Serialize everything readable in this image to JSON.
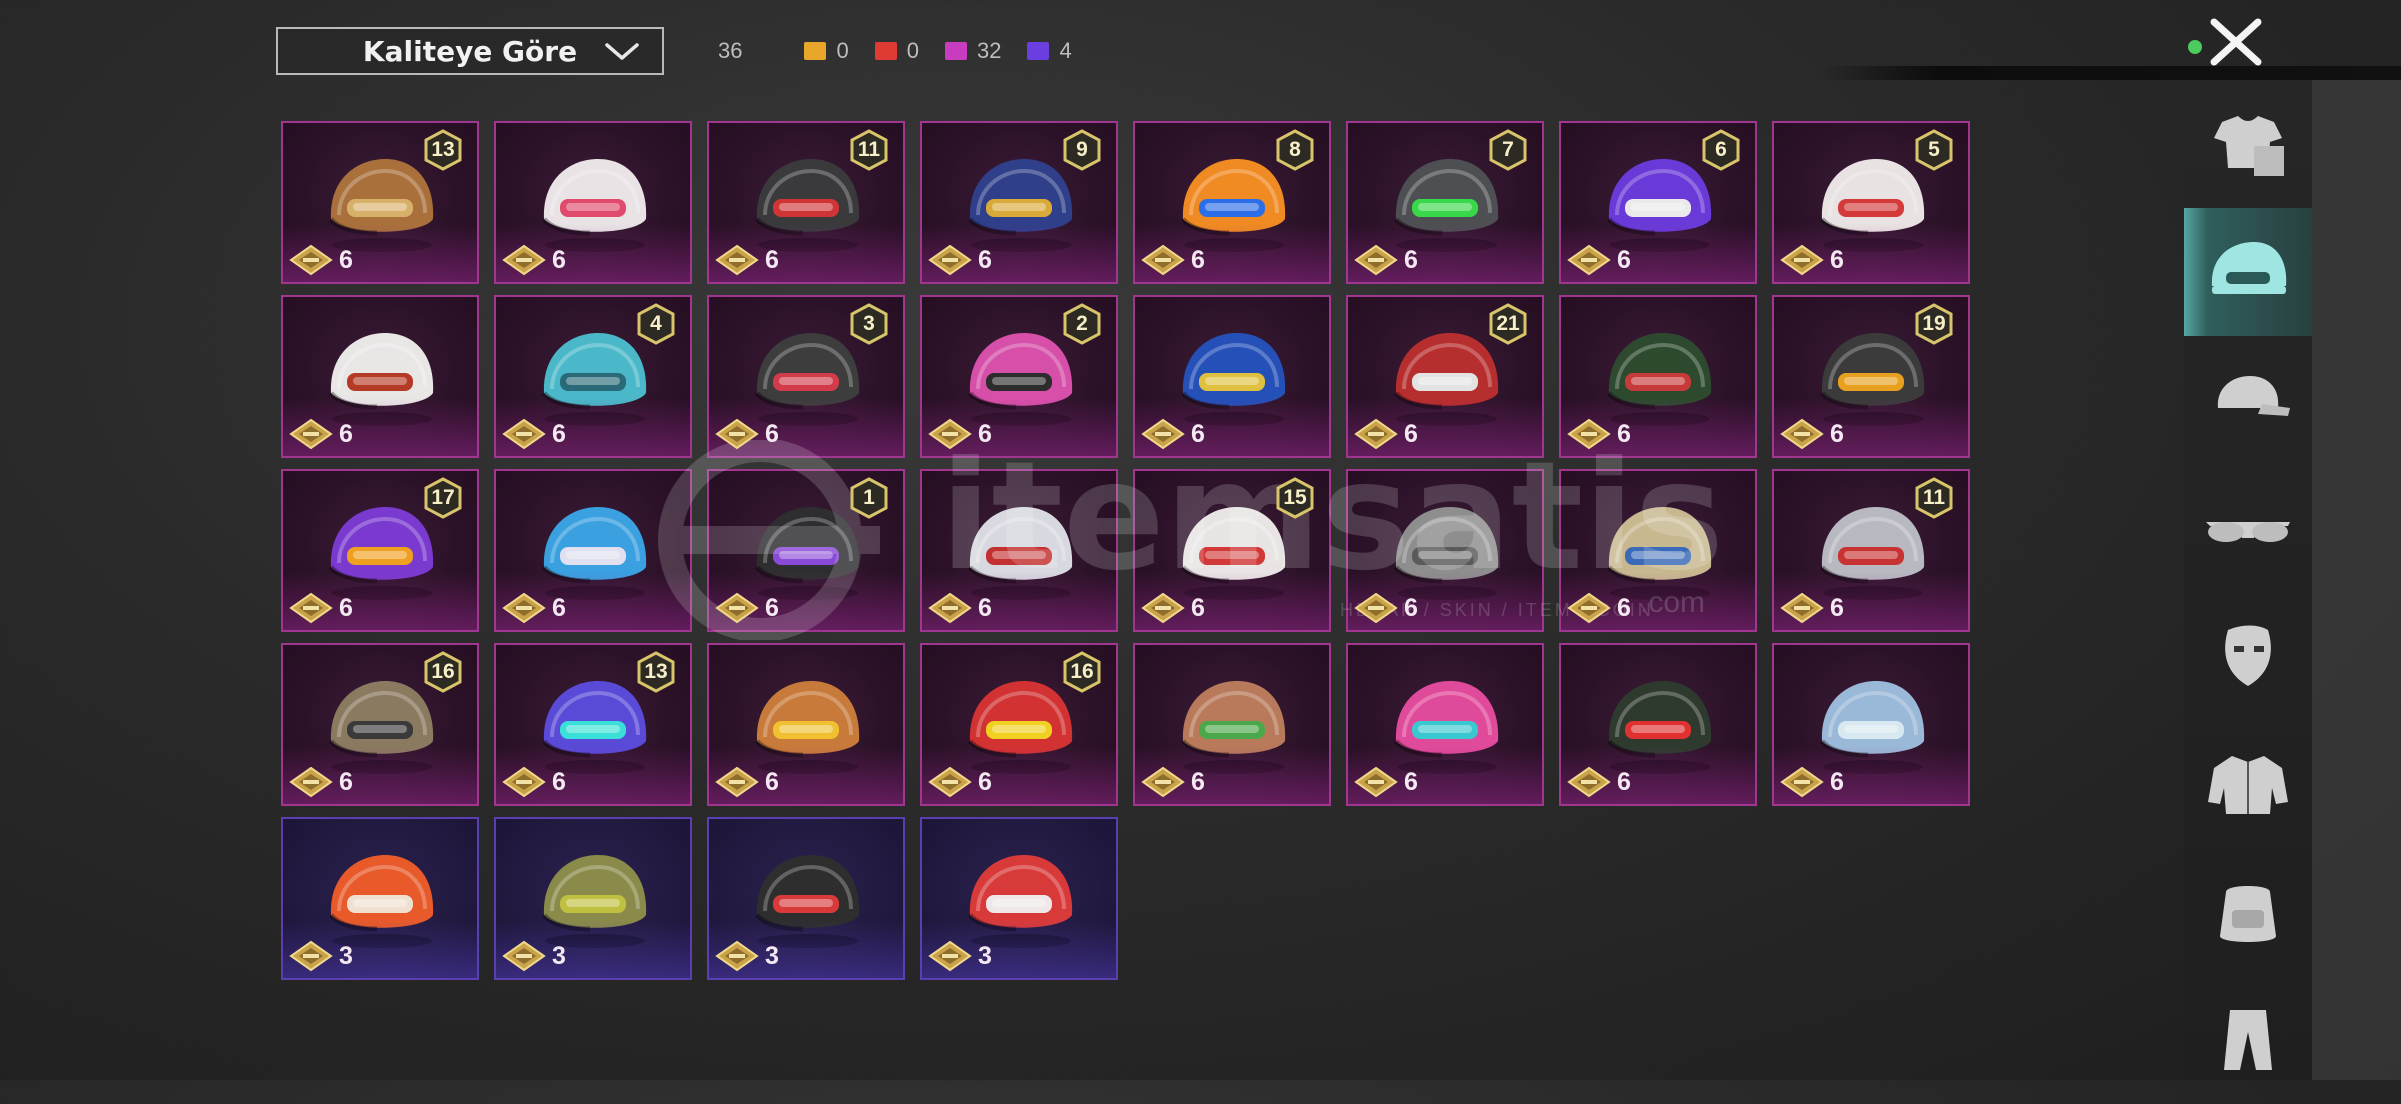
{
  "sort": {
    "label": "Kaliteye Göre"
  },
  "counts": {
    "total": "36",
    "tiers": [
      {
        "color": "#e8a72b",
        "value": "0"
      },
      {
        "color": "#e03a34",
        "value": "0"
      },
      {
        "color": "#c83cc0",
        "value": "32"
      },
      {
        "color": "#6b3ee0",
        "value": "4"
      }
    ]
  },
  "sidebar": {
    "items": [
      {
        "icon": "outfit-icon",
        "active": false
      },
      {
        "icon": "helmet-icon",
        "active": true
      },
      {
        "icon": "cap-icon",
        "active": false
      },
      {
        "icon": "sunglasses-icon",
        "active": false
      },
      {
        "icon": "mask-icon",
        "active": false
      },
      {
        "icon": "jacket-icon",
        "active": false
      },
      {
        "icon": "backpack-icon",
        "active": false
      },
      {
        "icon": "pants-icon",
        "active": false
      }
    ]
  },
  "items": [
    {
      "badge": "13",
      "cost": "6",
      "rarity": "mythic",
      "colors": [
        "#a9703c",
        "#d7b06a"
      ]
    },
    {
      "badge": "",
      "cost": "6",
      "rarity": "mythic",
      "colors": [
        "#e9e3e6",
        "#e04a6c"
      ]
    },
    {
      "badge": "11",
      "cost": "6",
      "rarity": "mythic",
      "colors": [
        "#3a3a3d",
        "#d13434"
      ]
    },
    {
      "badge": "9",
      "cost": "6",
      "rarity": "mythic",
      "colors": [
        "#2f3f8a",
        "#d9a93a"
      ]
    },
    {
      "badge": "8",
      "cost": "6",
      "rarity": "mythic",
      "colors": [
        "#f08a22",
        "#2b6ee8"
      ]
    },
    {
      "badge": "7",
      "cost": "6",
      "rarity": "mythic",
      "colors": [
        "#4d4f52",
        "#39d84a"
      ]
    },
    {
      "badge": "6",
      "cost": "6",
      "rarity": "mythic",
      "colors": [
        "#6a3ad8",
        "#eaeaea"
      ]
    },
    {
      "badge": "5",
      "cost": "6",
      "rarity": "mythic",
      "colors": [
        "#e8e2e2",
        "#d43a3a"
      ]
    },
    {
      "badge": "",
      "cost": "6",
      "rarity": "mythic",
      "colors": [
        "#e9e6e6",
        "#b53a26"
      ]
    },
    {
      "badge": "4",
      "cost": "6",
      "rarity": "mythic",
      "colors": [
        "#4ab8c8",
        "#2a6a78"
      ]
    },
    {
      "badge": "3",
      "cost": "6",
      "rarity": "mythic",
      "colors": [
        "#3d3d3d",
        "#d23c4a"
      ]
    },
    {
      "badge": "2",
      "cost": "6",
      "rarity": "mythic",
      "colors": [
        "#d64fa8",
        "#2c2c2c"
      ]
    },
    {
      "badge": "",
      "cost": "6",
      "rarity": "mythic",
      "colors": [
        "#2450b8",
        "#e0c040"
      ]
    },
    {
      "badge": "21",
      "cost": "6",
      "rarity": "mythic",
      "colors": [
        "#b72e2e",
        "#e3e3e3"
      ]
    },
    {
      "badge": "",
      "cost": "6",
      "rarity": "mythic",
      "colors": [
        "#2e4a2e",
        "#c63a3a"
      ]
    },
    {
      "badge": "19",
      "cost": "6",
      "rarity": "mythic",
      "colors": [
        "#3b3b3b",
        "#e8a020"
      ]
    },
    {
      "badge": "17",
      "cost": "6",
      "rarity": "mythic",
      "colors": [
        "#7a3ad0",
        "#f0a020"
      ]
    },
    {
      "badge": "",
      "cost": "6",
      "rarity": "mythic",
      "colors": [
        "#3aa0e0",
        "#e0e0f0"
      ]
    },
    {
      "badge": "1",
      "cost": "6",
      "rarity": "mythic",
      "colors": [
        "#2e2e30",
        "#8a4ad8"
      ]
    },
    {
      "badge": "",
      "cost": "6",
      "rarity": "mythic",
      "colors": [
        "#d8d8e0",
        "#c43030"
      ]
    },
    {
      "badge": "15",
      "cost": "6",
      "rarity": "mythic",
      "colors": [
        "#e8e4e4",
        "#d23838"
      ]
    },
    {
      "badge": "",
      "cost": "6",
      "rarity": "mythic",
      "colors": [
        "#8e8e8e",
        "#5a5a5a"
      ]
    },
    {
      "badge": "",
      "cost": "6",
      "rarity": "mythic",
      "colors": [
        "#c8b890",
        "#3a6ab8"
      ]
    },
    {
      "badge": "11",
      "cost": "6",
      "rarity": "mythic",
      "colors": [
        "#b8b8c0",
        "#c83232"
      ]
    },
    {
      "badge": "16",
      "cost": "6",
      "rarity": "mythic",
      "colors": [
        "#8a7a60",
        "#3a3a3a"
      ]
    },
    {
      "badge": "13",
      "cost": "6",
      "rarity": "mythic",
      "colors": [
        "#5a4ad8",
        "#3ae0d8"
      ]
    },
    {
      "badge": "",
      "cost": "6",
      "rarity": "mythic",
      "colors": [
        "#c87a3a",
        "#f0c030"
      ]
    },
    {
      "badge": "16",
      "cost": "6",
      "rarity": "mythic",
      "colors": [
        "#d23232",
        "#f0d020"
      ]
    },
    {
      "badge": "",
      "cost": "6",
      "rarity": "mythic",
      "colors": [
        "#b87a5a",
        "#4aa84a"
      ]
    },
    {
      "badge": "",
      "cost": "6",
      "rarity": "mythic",
      "colors": [
        "#e04a9a",
        "#3ac8d0"
      ]
    },
    {
      "badge": "",
      "cost": "6",
      "rarity": "mythic",
      "colors": [
        "#2e3a2e",
        "#e03030"
      ]
    },
    {
      "badge": "",
      "cost": "6",
      "rarity": "mythic",
      "colors": [
        "#9ab8d8",
        "#d8e8f0"
      ]
    },
    {
      "badge": "",
      "cost": "3",
      "rarity": "epic",
      "colors": [
        "#e85a2a",
        "#f0e0d0"
      ]
    },
    {
      "badge": "",
      "cost": "3",
      "rarity": "epic",
      "colors": [
        "#8a8a4a",
        "#c0c040"
      ]
    },
    {
      "badge": "",
      "cost": "3",
      "rarity": "epic",
      "colors": [
        "#2e2e2e",
        "#d83a3a"
      ]
    },
    {
      "badge": "",
      "cost": "3",
      "rarity": "epic",
      "colors": [
        "#d83a3a",
        "#f0e8e8"
      ]
    }
  ],
  "watermark": {
    "text": "itemsatis",
    "sub": "HESAP / SKIN / ITEM / COIN",
    "tld": ".com"
  }
}
